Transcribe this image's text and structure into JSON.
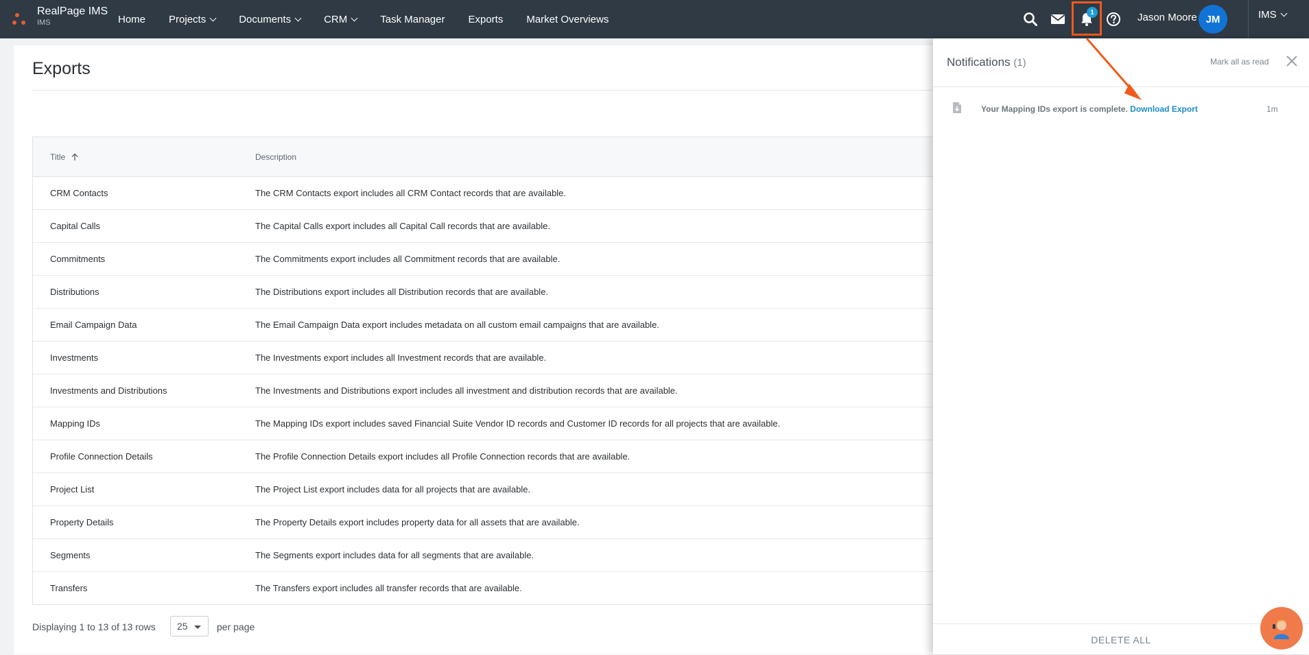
{
  "brand": {
    "name": "RealPage IMS",
    "sub": "IMS",
    "dot_color": "#e85a36"
  },
  "nav": {
    "items": [
      {
        "label": "Home",
        "has_dropdown": false
      },
      {
        "label": "Projects",
        "has_dropdown": true
      },
      {
        "label": "Documents",
        "has_dropdown": true
      },
      {
        "label": "CRM",
        "has_dropdown": true
      },
      {
        "label": "Task Manager",
        "has_dropdown": false
      },
      {
        "label": "Exports",
        "has_dropdown": false
      },
      {
        "label": "Market Overviews",
        "has_dropdown": false
      }
    ],
    "notification_badge": "1",
    "user_name": "Jason Moore",
    "user_initials": "JM",
    "app_switcher": "IMS",
    "bg_color": "#2f3a44",
    "accent_color": "#1273d6",
    "highlight_color": "#f05a1a"
  },
  "page": {
    "title": "Exports",
    "columns": {
      "title": "Title",
      "description": "Description"
    },
    "rows": [
      {
        "title": "CRM Contacts",
        "description": "The CRM Contacts export includes all CRM Contact records that are available."
      },
      {
        "title": "Capital Calls",
        "description": "The Capital Calls export includes all Capital Call records that are available."
      },
      {
        "title": "Commitments",
        "description": "The Commitments export includes all Commitment records that are available."
      },
      {
        "title": "Distributions",
        "description": "The Distributions export includes all Distribution records that are available."
      },
      {
        "title": "Email Campaign Data",
        "description": "The Email Campaign Data export includes metadata on all custom email campaigns that are available."
      },
      {
        "title": "Investments",
        "description": "The Investments export includes all Investment records that are available."
      },
      {
        "title": "Investments and Distributions",
        "description": "The Investments and Distributions export includes all investment and distribution records that are available."
      },
      {
        "title": "Mapping IDs",
        "description": "The Mapping IDs export includes saved Financial Suite Vendor ID records and Customer ID records for all projects that are available."
      },
      {
        "title": "Profile Connection Details",
        "description": "The Profile Connection Details export includes all Profile Connection records that are available."
      },
      {
        "title": "Project List",
        "description": "The Project List export includes data for all projects that are available."
      },
      {
        "title": "Property Details",
        "description": "The Property Details export includes property data for all assets that are available."
      },
      {
        "title": "Segments",
        "description": "The Segments export includes data for all segments that are available."
      },
      {
        "title": "Transfers",
        "description": "The Transfers export includes all transfer records that are available."
      }
    ],
    "footer": {
      "displaying": "Displaying 1 to 13 of 13 rows",
      "per_page_value": "25",
      "per_page_label": "per page"
    }
  },
  "notifications": {
    "title": "Notifications",
    "count": "(1)",
    "mark_all": "Mark all as read",
    "items": [
      {
        "icon": "file-download-icon",
        "message": "Your Mapping IDs export is complete.",
        "link": "Download Export",
        "time": "1m"
      }
    ],
    "delete_all": "DELETE ALL",
    "link_color": "#1a8dc8"
  }
}
